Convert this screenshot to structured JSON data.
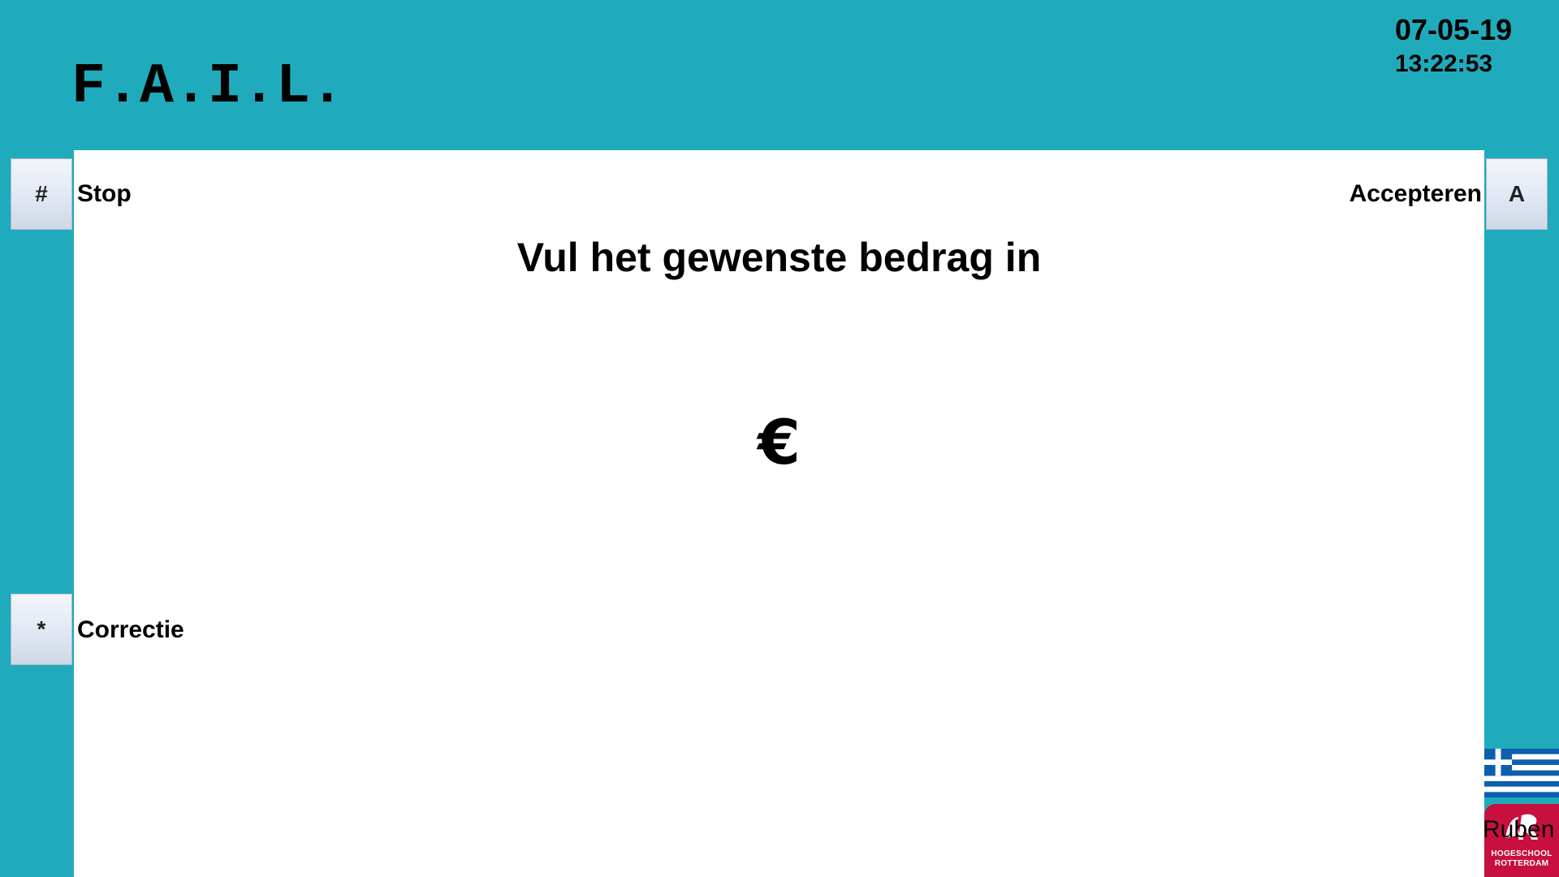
{
  "header": {
    "logo_text": "F.A.I.L.",
    "date": "07-05-19",
    "time": "13:22:53"
  },
  "keys": {
    "stop": {
      "key": "#",
      "label": "Stop"
    },
    "accept": {
      "key": "A",
      "label": "Accepteren"
    },
    "correct": {
      "key": "*",
      "label": "Correctie"
    }
  },
  "main": {
    "prompt": "Vul het gewenste bedrag in",
    "currency_symbol": "€",
    "amount": ""
  },
  "footer": {
    "language_flag": "greece-flag-icon",
    "user_name": "Ruben",
    "school_name_line1": "HOGESCHOOL",
    "school_name_line2": "ROTTERDAM"
  },
  "colors": {
    "background": "#20abbc",
    "panel": "#ffffff",
    "school_red": "#c8103e",
    "flag_blue": "#0d5eaf"
  }
}
